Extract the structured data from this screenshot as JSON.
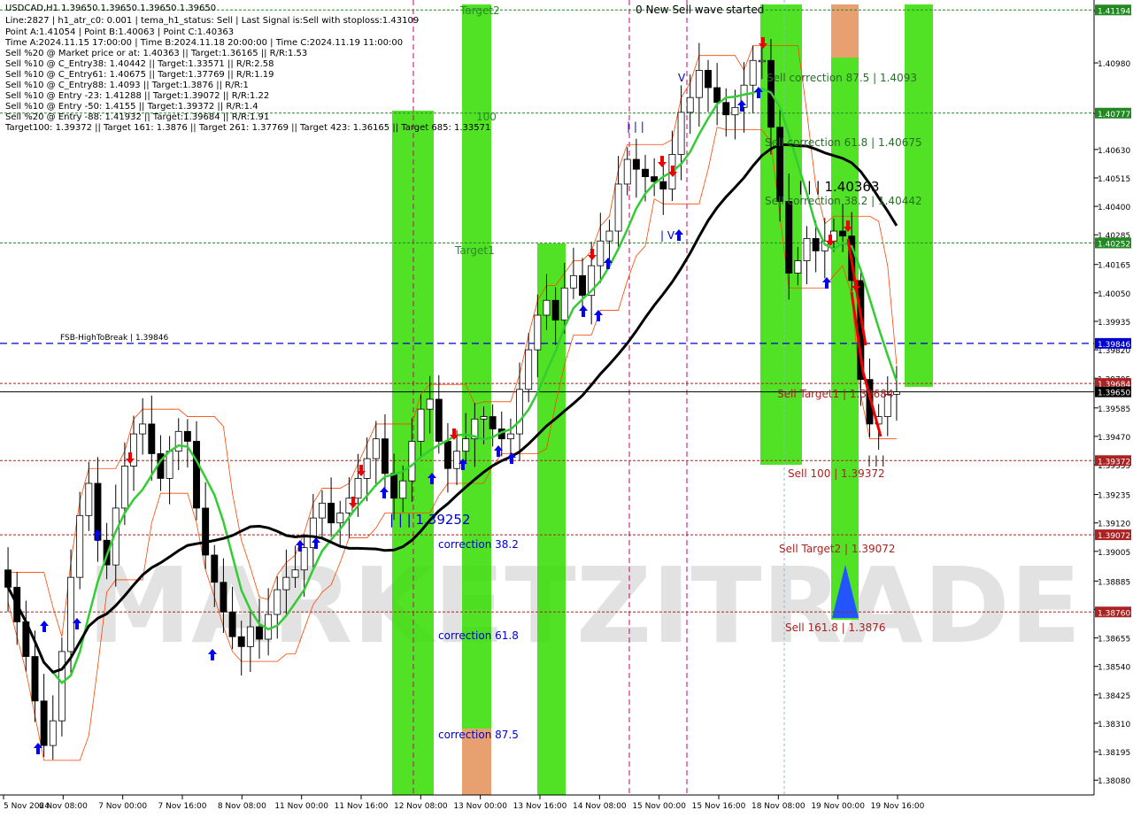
{
  "colors": {
    "background": "#ffffff",
    "candle": "#000000",
    "green_zone": "#33dd00",
    "orange_zone": "#e8a070",
    "sma_green": "#33cc33",
    "sma_black": "#000000",
    "channel_red": "#ff4400",
    "level_green": "#228822",
    "level_red": "#aa2222",
    "level_blue": "#0000cc",
    "vline_magenta": "#cc0077",
    "arrow_blue": "#0000ee",
    "arrow_red": "#ee0000",
    "watermark": "#d9d9d9"
  },
  "header": {
    "lines": [
      "USDCAD,H1  1.39650 1.39650 1.39650 1.39650",
      "Line:2827  |  h1_atr_c0: 0.001  |  tema_h1_status: Sell  |  Last Signal is:Sell with stoploss:1.43109",
      "Point A:1.41054  |  Point B:1.40063  |  Point C:1.40363",
      "Time A:2024.11.15 17:00:00  |  Time B:2024.11.18 20:00:00  |  Time C:2024.11.19 11:00:00",
      "Sell %20 @ Market price or at: 1.40363  ||  Target:1.36165  ||  R/R:1.53",
      "Sell %10 @ C_Entry38: 1.40442  ||  Target:1.33571  ||  R/R:2.58",
      "Sell %10 @ C_Entry61: 1.40675  ||  Target:1.37769  ||  R/R:1.19",
      "Sell %10 @ C_Entry88: 1.4093  ||  Target:1.3876  ||  R/R:1",
      "Sell %10 @ Entry -23: 1.41288  ||  Target:1.39072  ||  R/R:1.22",
      "Sell %10 @ Entry -50: 1.4155  ||  Target:1.39372  ||  R/R:1.4",
      "Sell %20 @ Entry -88: 1.41932  ||  Target:1.39684  ||  R/R:1.91",
      "Target100: 1.39372  ||  Target 161: 1.3876  ||  Target 261: 1.37769  ||  Target 423: 1.36165  ||  Target 685: 1.33571"
    ]
  },
  "watermark": "MARKETZITRADE",
  "chart_data": {
    "type": "candlestick",
    "symbol": "USDCAD",
    "timeframe": "H1",
    "ylim": [
      1.38,
      1.412
    ],
    "y_ticks": [
      "1.41190",
      "1.40980",
      "1.40775",
      "1.40630",
      "1.40515",
      "1.40400",
      "1.40285",
      "1.40165",
      "1.40050",
      "1.39935",
      "1.39820",
      "1.39705",
      "1.39585",
      "1.39470",
      "1.39355",
      "1.39235",
      "1.39120",
      "1.39005",
      "1.38885",
      "1.38770",
      "1.38655",
      "1.38540",
      "1.38425",
      "1.38310",
      "1.38195",
      "1.38080"
    ],
    "x_ticks": [
      "5 Nov 2024",
      "6 Nov 08:00",
      "7 Nov 00:00",
      "7 Nov 16:00",
      "8 Nov 08:00",
      "11 Nov 00:00",
      "11 Nov 16:00",
      "12 Nov 08:00",
      "13 Nov 00:00",
      "13 Nov 16:00",
      "14 Nov 08:00",
      "15 Nov 00:00",
      "15 Nov 16:00",
      "18 Nov 08:00",
      "19 Nov 00:00",
      "19 Nov 16:00"
    ],
    "closes": [
      1.3886,
      1.3872,
      1.3858,
      1.384,
      1.3822,
      1.3832,
      1.386,
      1.389,
      1.3915,
      1.3928,
      1.3905,
      1.3895,
      1.3918,
      1.3935,
      1.3948,
      1.3952,
      1.394,
      1.393,
      1.3941,
      1.3949,
      1.3945,
      1.3918,
      1.3899,
      1.3888,
      1.3876,
      1.3866,
      1.3862,
      1.387,
      1.3865,
      1.3875,
      1.3885,
      1.389,
      1.3893,
      1.3902,
      1.3914,
      1.392,
      1.3912,
      1.3916,
      1.3922,
      1.393,
      1.3938,
      1.3946,
      1.3932,
      1.3922,
      1.3929,
      1.3945,
      1.3958,
      1.3962,
      1.3945,
      1.3934,
      1.3941,
      1.3946,
      1.3954,
      1.3955,
      1.395,
      1.3946,
      1.3948,
      1.3966,
      1.3982,
      1.3996,
      1.4002,
      1.3994,
      1.4007,
      1.4012,
      1.4004,
      1.4016,
      1.4026,
      1.403,
      1.4049,
      1.4059,
      1.4055,
      1.4052,
      1.405,
      1.4047,
      1.4061,
      1.4078,
      1.4084,
      1.4095,
      1.4088,
      1.4082,
      1.4077,
      1.408,
      1.4089,
      1.4099,
      1.4099,
      1.4072,
      1.4042,
      1.4013,
      1.4018,
      1.4027,
      1.4022,
      1.4026,
      1.403,
      1.4028,
      1.401,
      1.397,
      1.3952,
      1.3955,
      1.3964,
      1.3965
    ],
    "levels": [
      {
        "price": "1.41194",
        "label": "",
        "side": "green"
      },
      {
        "price": "1.40777",
        "label": "",
        "side": "green"
      },
      {
        "price": "1.40252",
        "label": "",
        "side": "green"
      },
      {
        "price": "1.39846",
        "label": "FSB-HighToBreak  |  1.39846",
        "side": "blue"
      },
      {
        "price": "1.39684",
        "label": "",
        "side": "red"
      },
      {
        "price": "1.39650",
        "label": "",
        "side": "black"
      },
      {
        "price": "1.39372",
        "label": "",
        "side": "red"
      },
      {
        "price": "1.39072",
        "label": "",
        "side": "red"
      },
      {
        "price": "1.38760",
        "label": "",
        "side": "red"
      }
    ],
    "annotations": {
      "target2": "Target2",
      "target1": "Target1",
      "hundred": "100",
      "new_sell": "0 New Sell wave started",
      "sell_corr_875": "Sell correction 87.5 | 1.4093",
      "sell_corr_618": "Sell correction 61.8 | 1.40675",
      "sell_corr_382": "Sell correction 38.2 | 1.40442",
      "c_point": "| | | 1.40363",
      "b_point": "| | | 1.39252",
      "corr_382": "correction 38.2",
      "corr_618": "correction 61.8",
      "corr_875": "correction 87.5",
      "sell_target1": "Sell Target1 | 1.39684",
      "sell_100": "Sell 100 | 1.39372",
      "sell_target2": "Sell Target2 | 1.39072",
      "sell_1618": "Sell 161.8 | 1.3876"
    }
  }
}
